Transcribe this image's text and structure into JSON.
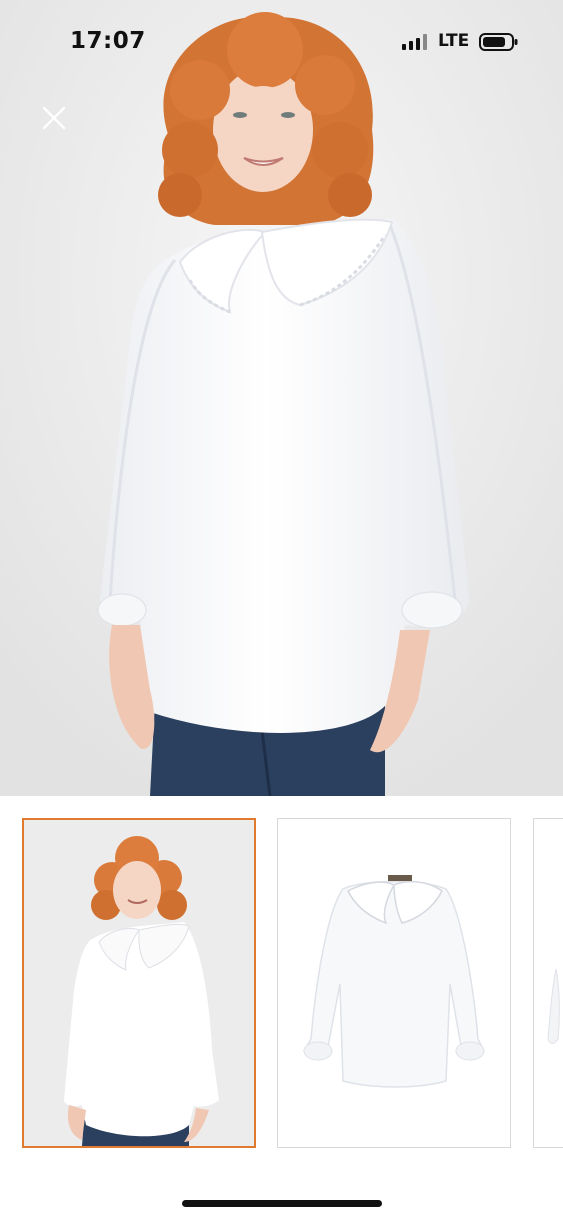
{
  "status_bar": {
    "time": "17:07",
    "network": "LTE",
    "signal_bars": 4,
    "battery_level": 0.8
  },
  "icons": {
    "close": "close-icon",
    "signal": "cellular-signal-icon",
    "battery": "battery-icon"
  },
  "gallery": {
    "selected_index": 0,
    "thumbnails": [
      {
        "subject": "model-wearing-blouse"
      },
      {
        "subject": "blouse-product-only"
      },
      {
        "subject": "partial-next-thumbnail"
      }
    ]
  },
  "colors": {
    "selected_border": "#e07a2e",
    "thumb_border": "#d8d8d8",
    "hair": "#d9793a",
    "jeans": "#2b3f5f"
  }
}
